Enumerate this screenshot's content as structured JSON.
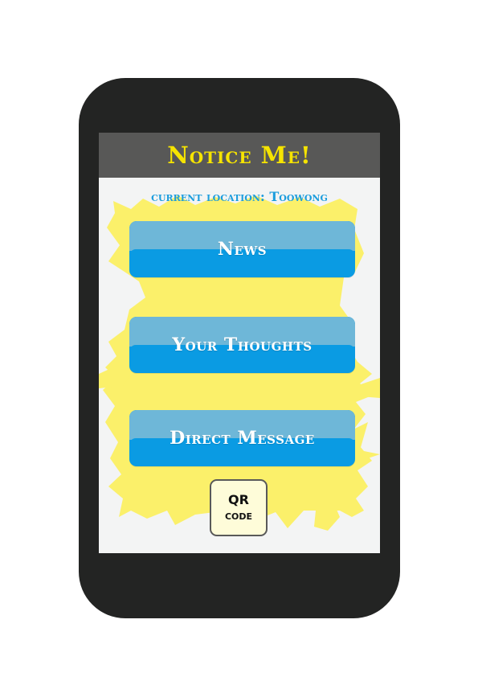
{
  "app": {
    "title": "Notice Me!",
    "location_text": "current location: Toowong"
  },
  "buttons": [
    {
      "label": "News"
    },
    {
      "label": "Your Thoughts"
    },
    {
      "label": "Direct Message"
    }
  ],
  "qr": {
    "line1": "QR",
    "line2": "code"
  },
  "colors": {
    "phone_body": "#232423",
    "title_bar": "#585857",
    "title_text": "#f6e400",
    "location_text": "#1c9ddd",
    "button_top": "#6eb7d8",
    "button_bottom": "#0a9be3",
    "splat": "#fbf06a",
    "qr_bg": "#fefcd9"
  }
}
